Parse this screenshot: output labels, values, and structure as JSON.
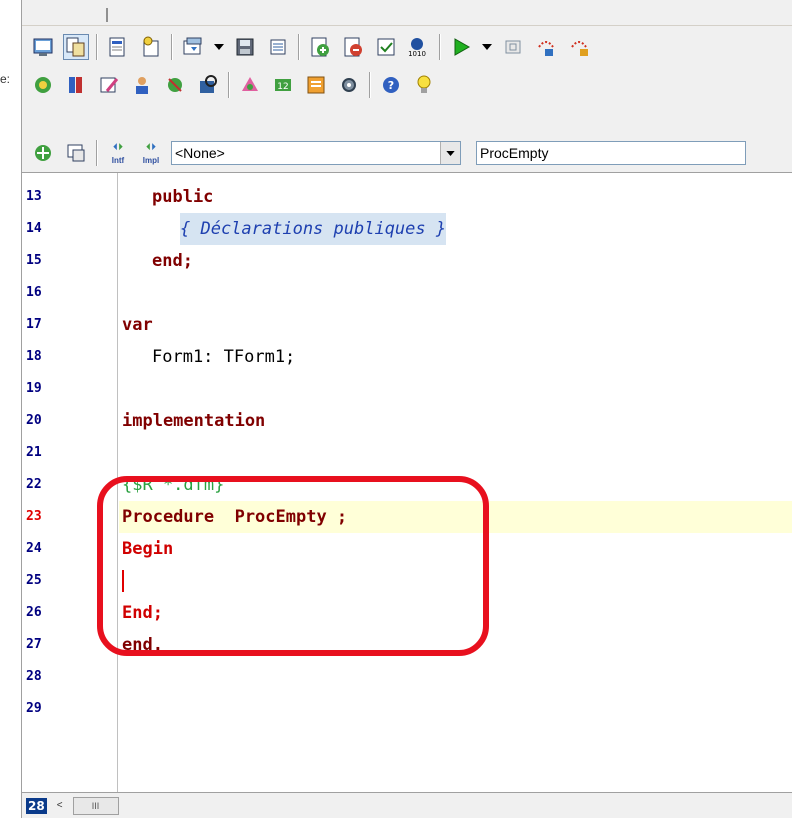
{
  "left_fragment": "e:",
  "combo_unit": {
    "value": "<None>"
  },
  "combo_proc": {
    "value": "ProcEmpty"
  },
  "intf_label": "Intf",
  "impl_label": "Impl",
  "status": {
    "line_badge": "28",
    "scroll_left": "<",
    "scroll_thumb": "III"
  },
  "annotation_color": "#e8101e",
  "lines": [
    {
      "n": "13",
      "text": "public"
    },
    {
      "n": "14",
      "text": "{ Déclarations publiques }"
    },
    {
      "n": "15",
      "text": "end;"
    },
    {
      "n": "16",
      "text": ""
    },
    {
      "n": "17",
      "text": "var"
    },
    {
      "n": "18",
      "text": "Form1: TForm1;"
    },
    {
      "n": "19",
      "text": ""
    },
    {
      "n": "20",
      "text": "implementation"
    },
    {
      "n": "21",
      "text": ""
    },
    {
      "n": "22",
      "text": "{$R *.dfm}"
    },
    {
      "n": "23",
      "text": "Procedure  ProcEmpty ;"
    },
    {
      "n": "24",
      "text": "Begin"
    },
    {
      "n": "25",
      "text": ""
    },
    {
      "n": "26",
      "text": "End;"
    },
    {
      "n": "27",
      "text": "end."
    },
    {
      "n": "28",
      "text": ""
    },
    {
      "n": "29",
      "text": ""
    }
  ]
}
